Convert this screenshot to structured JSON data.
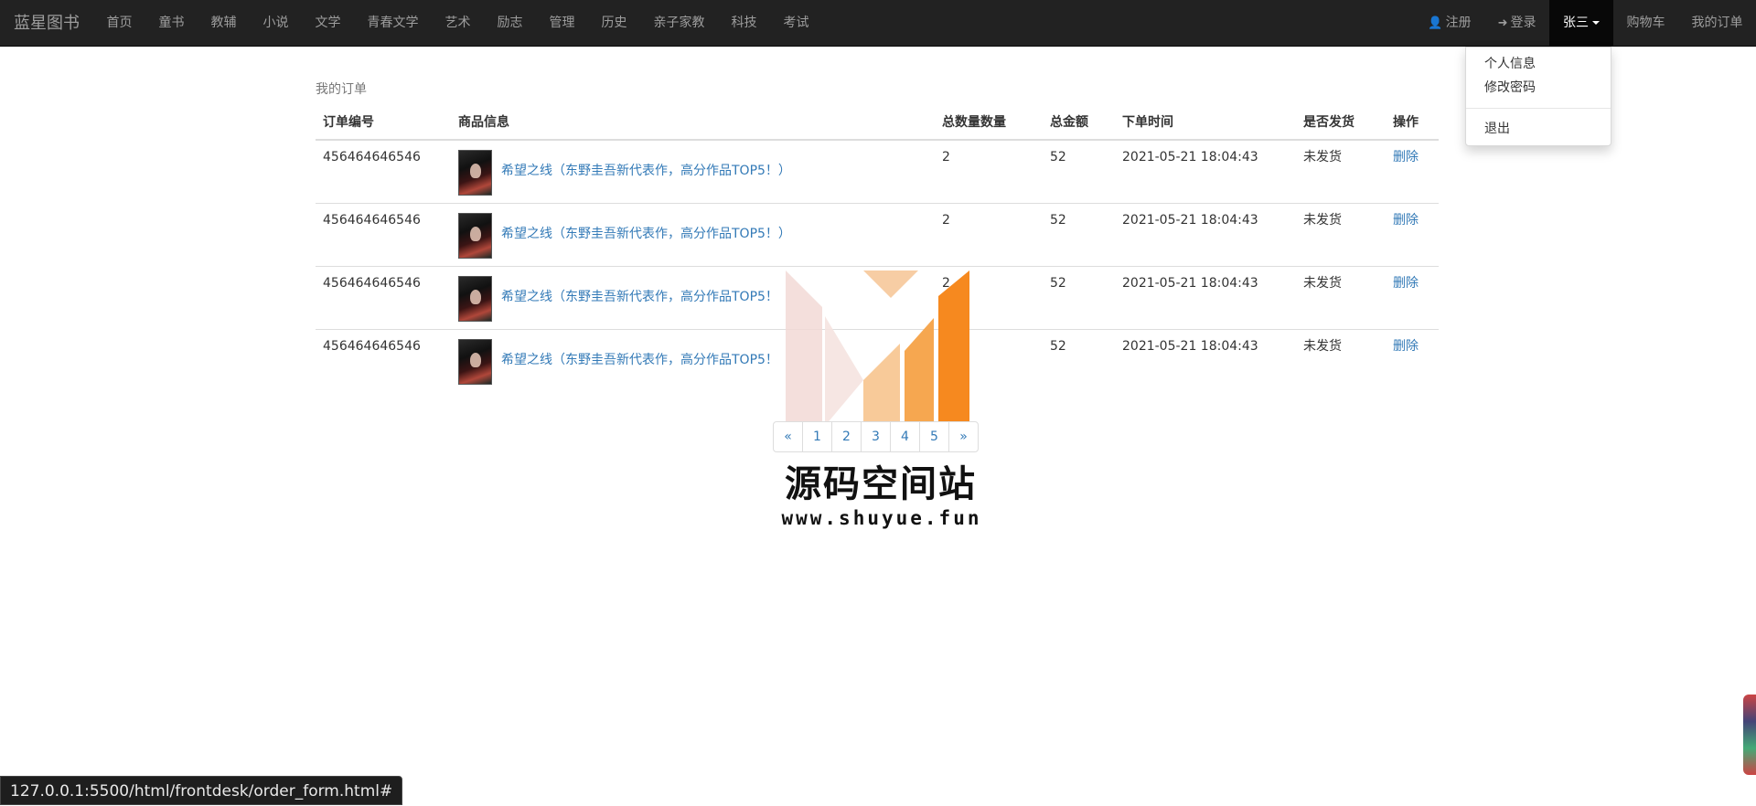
{
  "navbar": {
    "brand": "蓝星图书",
    "categories": [
      "首页",
      "童书",
      "教辅",
      "小说",
      "文学",
      "青春文学",
      "艺术",
      "励志",
      "管理",
      "历史",
      "亲子家教",
      "科技",
      "考试"
    ],
    "register": "注册",
    "login": "登录",
    "user": "张三",
    "cart": "购物车",
    "my_orders": "我的订单"
  },
  "dropdown": {
    "profile": "个人信息",
    "change_password": "修改密码",
    "logout": "退出"
  },
  "page": {
    "caption": "我的订单"
  },
  "table": {
    "headers": [
      "订单编号",
      "商品信息",
      "总数量数量",
      "总金额",
      "下单时间",
      "是否发货",
      "操作"
    ],
    "rows": [
      {
        "order_no": "456464646546",
        "goods": "希望之线（东野圭吾新代表作，高分作品TOP5！）",
        "qty": "2",
        "amount": "52",
        "time": "2021-05-21 18:04:43",
        "shipped": "未发货",
        "action": "删除"
      },
      {
        "order_no": "456464646546",
        "goods": "希望之线（东野圭吾新代表作，高分作品TOP5！）",
        "qty": "2",
        "amount": "52",
        "time": "2021-05-21 18:04:43",
        "shipped": "未发货",
        "action": "删除"
      },
      {
        "order_no": "456464646546",
        "goods": "希望之线（东野圭吾新代表作，高分作品TOP5！",
        "qty": "2",
        "amount": "52",
        "time": "2021-05-21 18:04:43",
        "shipped": "未发货",
        "action": "删除"
      },
      {
        "order_no": "456464646546",
        "goods": "希望之线（东野圭吾新代表作，高分作品TOP5！",
        "qty": "",
        "amount": "52",
        "time": "2021-05-21 18:04:43",
        "shipped": "未发货",
        "action": "删除"
      }
    ]
  },
  "pagination": [
    "«",
    "1",
    "2",
    "3",
    "4",
    "5",
    "»"
  ],
  "watermark": {
    "name": "源码空间站",
    "url": "www.shuyue.fun"
  },
  "status_bar": {
    "url": "127.0.0.1:5500/html/frontdesk/order_form.html#"
  },
  "colors": {
    "navbar_bg": "#222222",
    "link": "#337ab7",
    "watermark_orange": "#f6891f"
  }
}
